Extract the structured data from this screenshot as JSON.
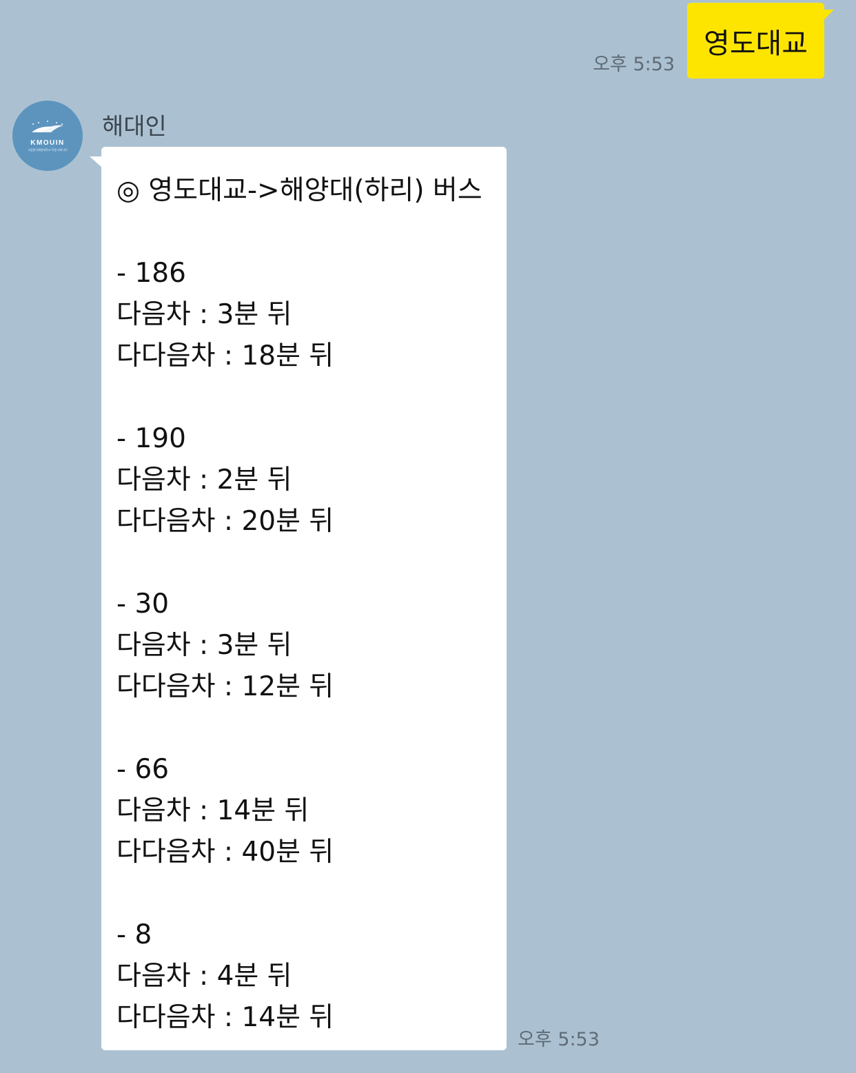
{
  "sent_message": {
    "time": "오후 5:53",
    "text": "영도대교"
  },
  "received_message": {
    "sender_name": "해대인",
    "avatar": {
      "logo_text": "KMOUIN",
      "sub_text": "국립한국해양대학교 학생 커뮤니티"
    },
    "title": "◎ 영도대교->해양대(하리) 버스",
    "routes": [
      {
        "number": "- 186",
        "next": "다음차 : 3분 뒤",
        "after_next": "다다음차 : 18분 뒤"
      },
      {
        "number": "- 190",
        "next": "다음차 : 2분 뒤",
        "after_next": "다다음차 : 20분 뒤"
      },
      {
        "number": "- 30",
        "next": "다음차 : 3분 뒤",
        "after_next": "다다음차 : 12분 뒤"
      },
      {
        "number": "- 66",
        "next": "다음차 : 14분 뒤",
        "after_next": "다다음차 : 40분 뒤"
      },
      {
        "number": "- 8",
        "next": "다음차 : 4분 뒤",
        "after_next": "다다음차 : 14분 뒤"
      }
    ],
    "time": "오후 5:53"
  },
  "colors": {
    "background": "#abc1d1",
    "sent_bubble": "#fee500",
    "received_bubble": "#ffffff",
    "avatar": "#5c94be",
    "timestamp": "#5f6b75"
  }
}
